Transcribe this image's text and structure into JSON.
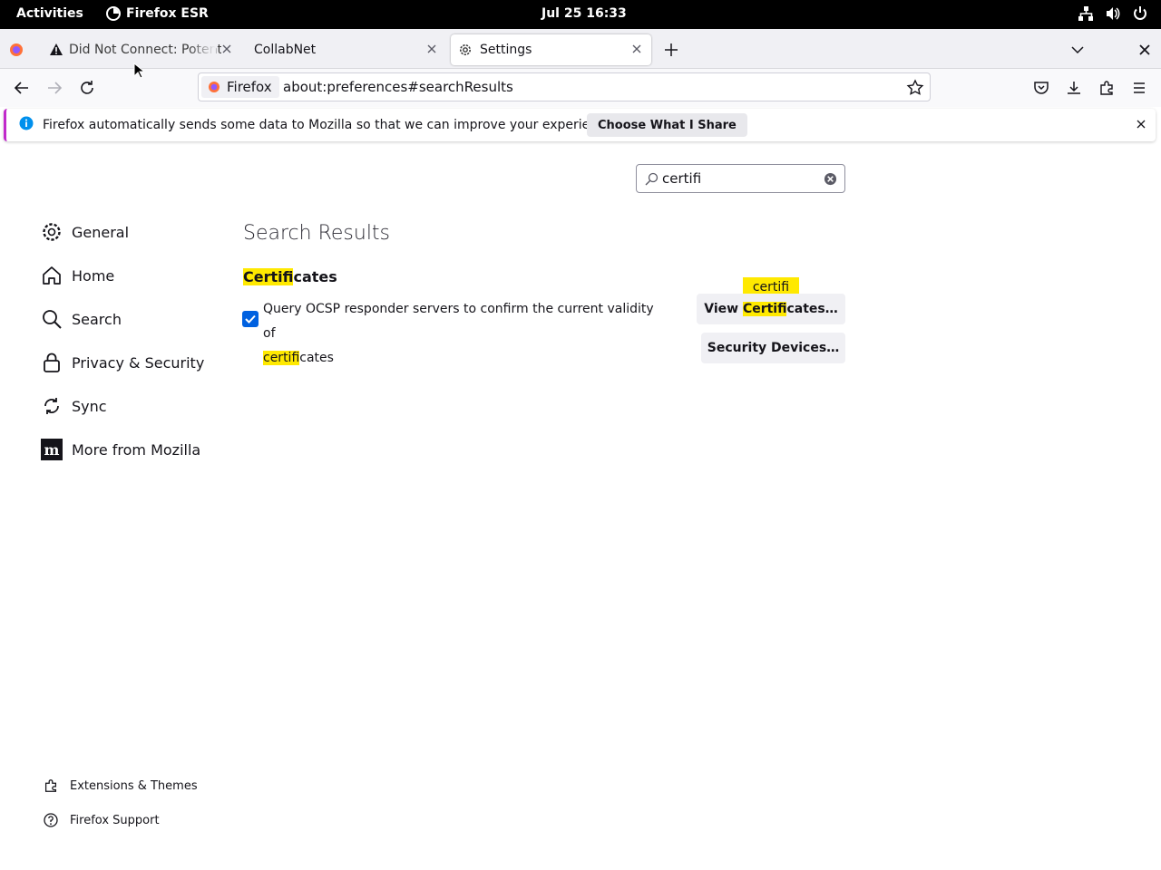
{
  "system": {
    "activities": "Activities",
    "app_name": "Firefox ESR",
    "clock": "Jul 25  16:33"
  },
  "tabs": [
    {
      "title": "Did Not Connect: Potenti",
      "icon": "warning-icon"
    },
    {
      "title": "CollabNet",
      "icon": ""
    },
    {
      "title": "Settings",
      "icon": "gear-icon"
    }
  ],
  "urlbar": {
    "identity": "Firefox",
    "url": "about:preferences#searchResults"
  },
  "notification": {
    "message": "Firefox automatically sends some data to Mozilla so that we can improve your experience.",
    "button": "Choose What I Share"
  },
  "search": {
    "value": "certifi"
  },
  "sidebar": {
    "items": [
      {
        "label": "General",
        "icon": "gear-icon"
      },
      {
        "label": "Home",
        "icon": "home-icon"
      },
      {
        "label": "Search",
        "icon": "search-icon"
      },
      {
        "label": "Privacy & Security",
        "icon": "lock-icon"
      },
      {
        "label": "Sync",
        "icon": "sync-icon"
      },
      {
        "label": "More from Mozilla",
        "icon": "mozilla-icon"
      }
    ],
    "footer": [
      {
        "label": "Extensions & Themes",
        "icon": "puzzle-icon"
      },
      {
        "label": "Firefox Support",
        "icon": "help-icon"
      }
    ]
  },
  "main": {
    "heading": "Search Results",
    "section": {
      "highlight": "Certifi",
      "rest": "cates"
    },
    "ocsp": {
      "label_line": "Query OCSP responder servers to confirm the current validity of",
      "label_hl": "certifi",
      "label_rest": "cates",
      "checked": true
    },
    "view_btn": {
      "pre": "View ",
      "hl": "Certifi",
      "post": "cates…"
    },
    "devices_btn": "Security Devices…",
    "tooltip": "certifi"
  },
  "colors": {
    "highlight": "#ffe900",
    "accent": "#0061e0",
    "notice_border": "#c12acb"
  }
}
